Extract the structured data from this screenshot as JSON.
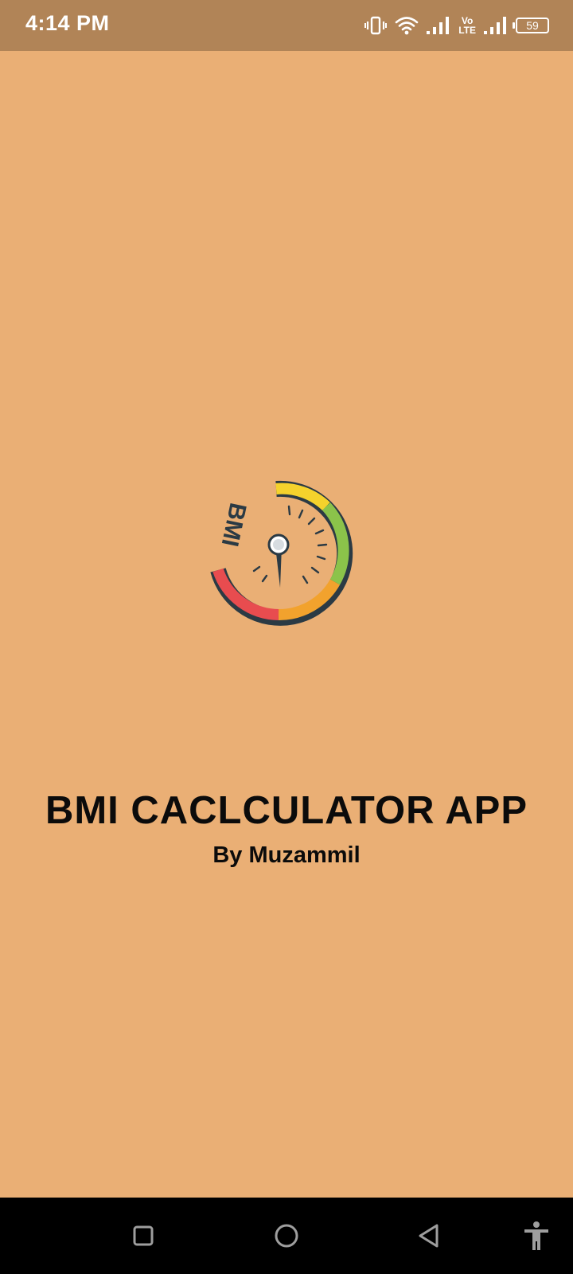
{
  "status_bar": {
    "time": "4:14 PM",
    "battery": "59",
    "network_label_top": "Vo",
    "network_label_bottom": "LTE",
    "icons": [
      "vibrate-icon",
      "wifi-icon",
      "signal-icon",
      "volte-icon",
      "signal-icon",
      "battery-icon"
    ]
  },
  "splash": {
    "logo_text": "BMI",
    "title": "BMI CACLCULATOR APP",
    "author": "By Muzammil"
  },
  "nav_bar": {
    "buttons": [
      "recents-button",
      "home-button",
      "back-button",
      "accessibility-button"
    ]
  },
  "colors": {
    "background": "#EAAF75",
    "status_bar": "#B18457",
    "nav_bar": "#000000",
    "gauge_red": "#E84C4F",
    "gauge_orange": "#F2A22D",
    "gauge_green": "#8BC34A",
    "gauge_yellow": "#F5D22C",
    "gauge_ink": "#2B3A44"
  }
}
